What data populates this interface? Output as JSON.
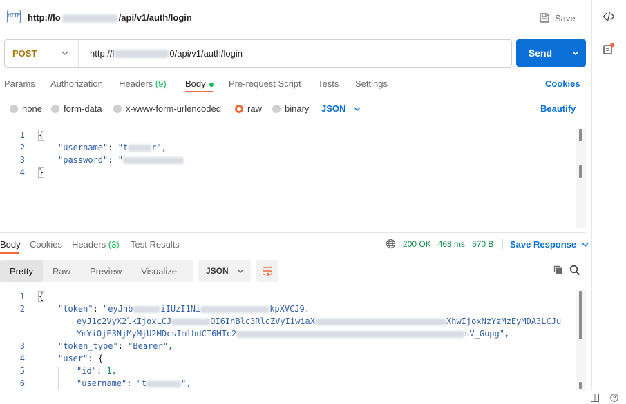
{
  "header": {
    "title_prefix": "http://lo",
    "title_suffix": "/api/v1/auth/login",
    "save_label": "Save"
  },
  "request": {
    "method": "POST",
    "url_prefix": "http://l",
    "url_suffix": "0/api/v1/auth/login",
    "send_label": "Send",
    "tabs": {
      "params": "Params",
      "authorization": "Authorization",
      "headers": "Headers",
      "headers_count": "(9)",
      "body": "Body",
      "prerequest": "Pre-request Script",
      "tests": "Tests",
      "settings": "Settings"
    },
    "cookies_label": "Cookies",
    "body_types": {
      "none": "none",
      "form_data": "form-data",
      "urlencoded": "x-www-form-urlencoded",
      "raw": "raw",
      "binary": "binary"
    },
    "body_format": "JSON",
    "beautify_label": "Beautify",
    "editor": {
      "line_numbers": [
        "1",
        "2",
        "3",
        "4"
      ],
      "open_brace": "{",
      "username_key": "\"username\"",
      "username_val_start": "\"t",
      "username_val_end": "r\",",
      "password_key": "\"password\"",
      "password_val_start": "\"",
      "close_brace": "}"
    }
  },
  "response": {
    "tabs": {
      "body": "Body",
      "cookies": "Cookies",
      "headers": "Headers",
      "headers_count": "(3)",
      "test_results": "Test Results"
    },
    "status": "200 OK",
    "time": "468 ms",
    "size": "570 B",
    "save_response_label": "Save Response",
    "view_tabs": {
      "pretty": "Pretty",
      "raw": "Raw",
      "preview": "Preview",
      "visualize": "Visualize"
    },
    "format": "JSON",
    "editor": {
      "line_numbers": [
        "1",
        "2",
        "",
        "",
        "3",
        "4",
        "5",
        "6"
      ],
      "open_brace": "{",
      "token_key": "\"token\"",
      "token_line1_start": "\"eyJhb",
      "token_line1_mid": "iIUzI1Ni",
      "token_line1_end": "kpXVCJ9.",
      "token_line2_start": "eyJ1c2VyX2lkIjoxLCJ",
      "token_line2_mid": "OI6InBlc3RlcZVyIiwiaX",
      "token_line2_end": "XhwIjoxNzYzMzEyMDA3LCJu",
      "token_line3_start": "YmYiOjE3NjMyMjU2MDcsImlhdCI6MTc2",
      "token_line3_end": "sV_Gupg\",",
      "token_type_key": "\"token_type\"",
      "token_type_val": "\"Bearer\",",
      "user_key": "\"user\"",
      "user_open": "{",
      "id_key": "\"id\"",
      "id_val": "1,",
      "username_key": "\"username\"",
      "username_val_start": "\"t",
      "username_val_end": "\","
    }
  },
  "icons": {
    "http": "HTTP",
    "code": "code-icon",
    "info": "info-icon"
  },
  "colors": {
    "accent": "#0b6fd8",
    "method_post": "#a4790b",
    "status_ok": "#0f8a47",
    "radio_selected": "#f26b3a",
    "body_dot": "#0cbb52"
  }
}
